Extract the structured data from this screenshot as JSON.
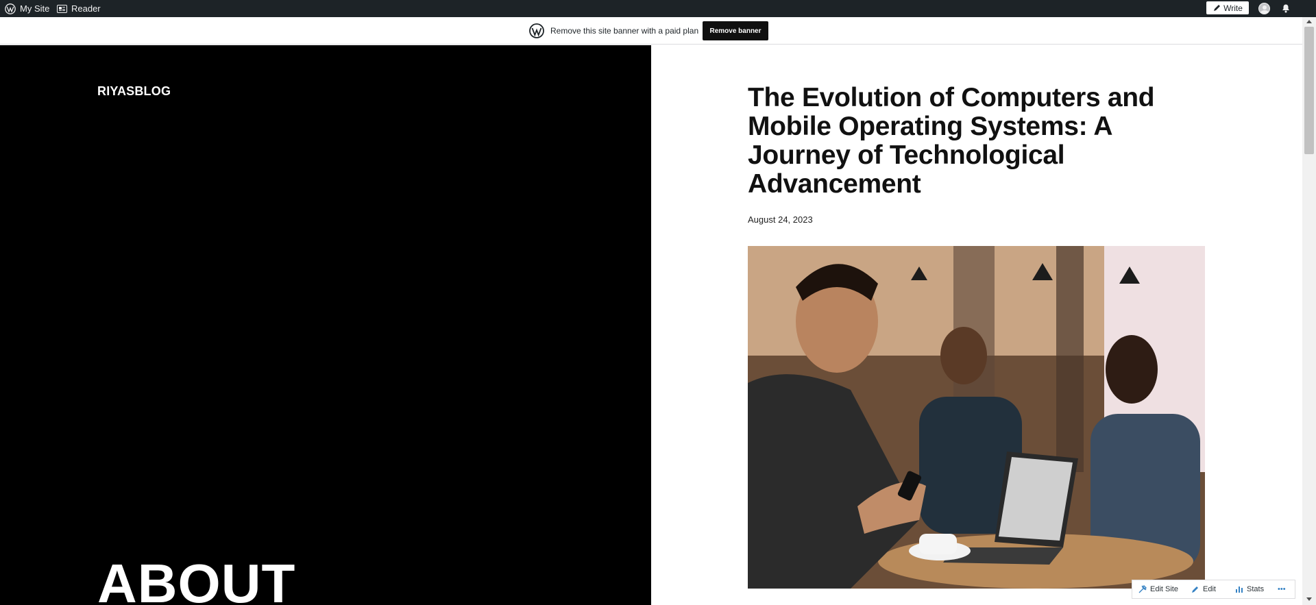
{
  "adminbar": {
    "my_site": "My Site",
    "reader": "Reader",
    "write": "Write"
  },
  "banner": {
    "text": "Remove this site banner with a paid plan",
    "button": "Remove banner"
  },
  "site": {
    "title": "RIYASBLOG",
    "about_heading": "ABOUT"
  },
  "post": {
    "title": "The Evolution of Computers and Mobile Operating Systems: A Journey of Technological Advancement",
    "date": "August 24, 2023"
  },
  "actionbar": {
    "edit_site": "Edit Site",
    "edit": "Edit",
    "stats": "Stats",
    "more": "•••"
  },
  "colors": {
    "adminbar_bg": "#1d2327",
    "panel_bg": "#000000",
    "button_bg": "#101010"
  }
}
